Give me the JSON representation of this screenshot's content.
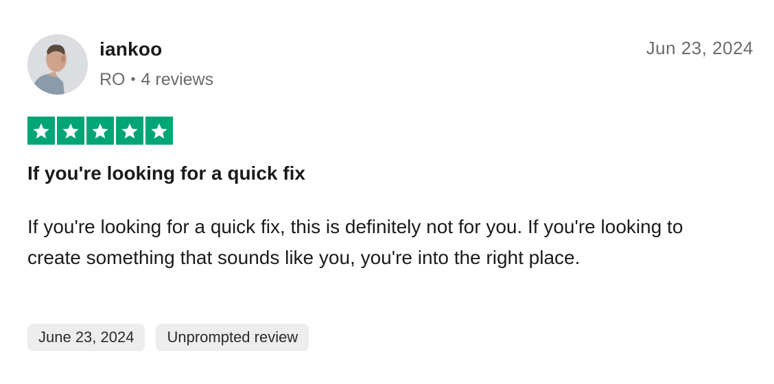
{
  "reviewer": {
    "username": "iankoo",
    "country": "RO",
    "separator": "•",
    "review_count": "4 reviews"
  },
  "review": {
    "date_header": "Jun 23, 2024",
    "rating": 5,
    "rating_max": 5,
    "title": "If you're looking for a quick fix",
    "body": "If you're looking for a quick fix, this is definitely not for you. If you're looking to create something that sounds like you, you're into the right place."
  },
  "tags": [
    "June 23, 2024",
    "Unprompted review"
  ],
  "colors": {
    "star_green": "#00a575",
    "tag_background": "#ededed",
    "muted_text": "#6b6b6b"
  },
  "icons": {
    "avatar": "avatar",
    "star": "star-icon"
  }
}
